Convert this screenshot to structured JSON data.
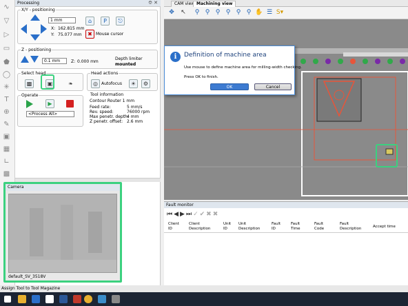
{
  "panel": {
    "title": "Processing"
  },
  "xy": {
    "title": "X/Y - positioning",
    "step": "1 mm",
    "x_label": "X:",
    "x_value": "162.815 mm",
    "y_label": "Y:",
    "y_value": "75.077 mm",
    "mouse_cursor_label": "Mouse cursor"
  },
  "z": {
    "title": "Z - positioning",
    "step": "0.1 mm",
    "z_label": "Z:",
    "z_value": "0.000 mm",
    "depth_limiter_label": "Depth limiter",
    "depth_limiter_value": "mounted"
  },
  "head": {
    "select_title": "Select head",
    "actions_title": "Head actions",
    "autofocus_label": "Autofocus"
  },
  "operate": {
    "title": "Operate",
    "process_select": "<Process All>"
  },
  "tool_info": {
    "title": "Tool information",
    "tool_name": "Contour Router 1 mm",
    "rows": [
      {
        "label": "Feed rate:",
        "value": "5 mm/s"
      },
      {
        "label": "Rev. speed:",
        "value": "76000 rpm"
      },
      {
        "label": "Max penetr. depth:",
        "value": "4 mm"
      },
      {
        "label": "Z penetr. offset:",
        "value": "2.6 mm"
      }
    ]
  },
  "camera": {
    "title": "Camera",
    "caption": "default_SV_3518V"
  },
  "tabs": [
    {
      "label": "CAM view"
    },
    {
      "label": "Machining view"
    }
  ],
  "dialog": {
    "title": "Definition of machine area",
    "line1": "Use mouse to define machine area for milling-width checking.",
    "line2": "Press OK to finish.",
    "ok": "OK",
    "cancel": "Cancel"
  },
  "fault_monitor": {
    "title": "Fault monitor",
    "columns": [
      {
        "l1": "Client",
        "l2": "ID"
      },
      {
        "l1": "Client",
        "l2": "Description"
      },
      {
        "l1": "Unit",
        "l2": "ID"
      },
      {
        "l1": "Unit",
        "l2": "Description"
      },
      {
        "l1": "Fault",
        "l2": "ID"
      },
      {
        "l1": "Fault",
        "l2": "Time"
      },
      {
        "l1": "Fault",
        "l2": "Code"
      },
      {
        "l1": "Fault",
        "l2": "Description"
      },
      {
        "l1": "Accept time",
        "l2": ""
      }
    ]
  },
  "status_bar": {
    "text": "Assign Tool to Tool Magazine"
  },
  "colors": {
    "accent_highlight": "#3bd17f",
    "dialog_blue": "#2a6fc9",
    "machine_red": "#e8553a"
  }
}
